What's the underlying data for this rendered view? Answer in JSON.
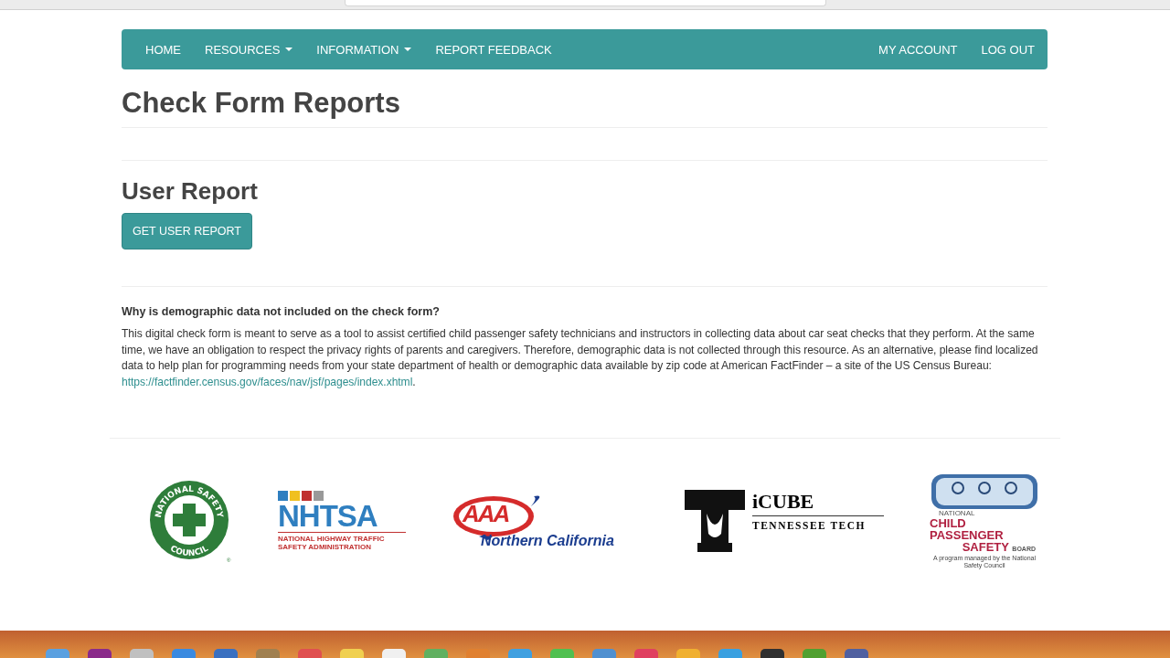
{
  "nav": {
    "left": [
      {
        "label": "HOME",
        "dropdown": false
      },
      {
        "label": "RESOURCES",
        "dropdown": true
      },
      {
        "label": "INFORMATION",
        "dropdown": true
      },
      {
        "label": "REPORT FEEDBACK",
        "dropdown": false
      }
    ],
    "right": [
      {
        "label": "MY ACCOUNT"
      },
      {
        "label": "LOG OUT"
      }
    ]
  },
  "page_title": "Check Form Reports",
  "section_title": "User Report",
  "report_button": "GET USER REPORT",
  "faq": {
    "question": "Why is demographic data not included on the check form?",
    "answer": "This digital check form is meant to serve as a tool to assist certified child passenger safety technicians and instructors in collecting data about car seat checks that they perform. At the same time, we have an obligation to respect the privacy rights of parents and caregivers. Therefore, demographic data is not collected through this resource. As an alternative, please find localized data to help plan for programming needs from your state department of health or demographic data available by zip code at American FactFinder – a site of the US Census Bureau: ",
    "link": "https://factfinder.census.gov/faces/nav/jsf/pages/index.xhtml",
    "after_link": "."
  },
  "logos": [
    {
      "kind": "nsc",
      "top": "NATIONAL SAFETY",
      "bottom": "COUNCIL",
      "mark": "®"
    },
    {
      "kind": "nhtsa",
      "name": "NHTSA",
      "line1": "NATIONAL HIGHWAY TRAFFIC",
      "line2": "SAFETY ADMINISTRATION"
    },
    {
      "kind": "aaa",
      "name": "AAA",
      "region": "Northern California"
    },
    {
      "kind": "icube",
      "name": "iCUBE",
      "sub": "TENNESSEE TECH"
    },
    {
      "kind": "ncpsb",
      "line1": "NATIONAL",
      "line2": "CHILD PASSENGER",
      "line3": "SAFETY",
      "line3b": "BOARD",
      "note": "A program managed by the National Safety Council"
    }
  ]
}
